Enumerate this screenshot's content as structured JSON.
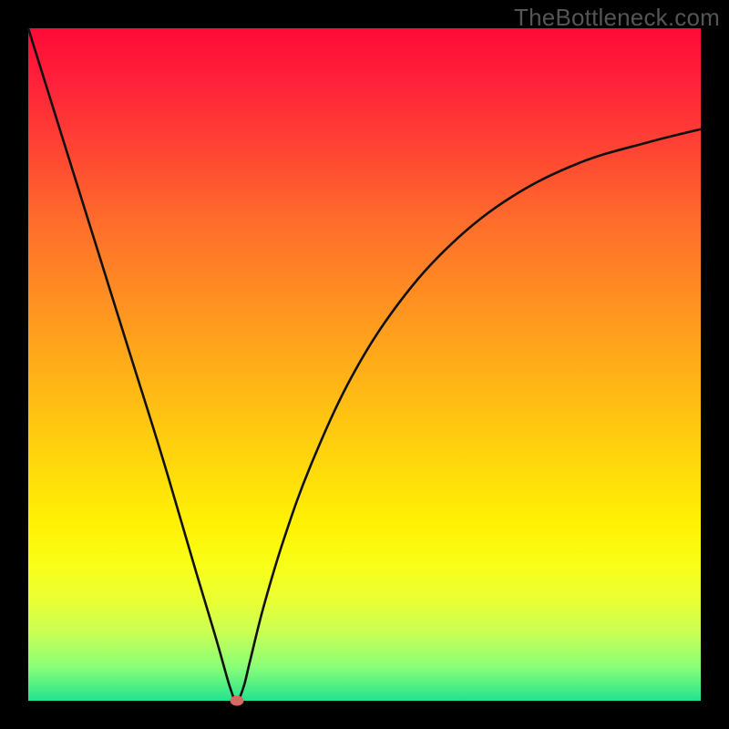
{
  "watermark": "TheBottleneck.com",
  "colors": {
    "frame": "#000000",
    "curve": "#111111",
    "marker": "#d66a63"
  },
  "chart_data": {
    "type": "line",
    "title": "",
    "xlabel": "",
    "ylabel": "",
    "xlim": [
      0,
      100
    ],
    "ylim": [
      0,
      100
    ],
    "series": [
      {
        "name": "curve",
        "x": [
          0,
          5,
          10,
          15,
          20,
          25,
          28,
          30,
          31,
          32,
          33,
          35,
          38,
          42,
          48,
          55,
          63,
          72,
          82,
          92,
          100
        ],
        "y": [
          100,
          84,
          68,
          52,
          36,
          19,
          9,
          2,
          0,
          2,
          6,
          14,
          24,
          35,
          48,
          59,
          68,
          75,
          80,
          83,
          85
        ]
      }
    ],
    "marker": {
      "x": 31,
      "y": 0
    },
    "background_gradient": {
      "top": "#ff0a38",
      "mid": "#ffd60c",
      "bottom": "#22e38f"
    }
  }
}
